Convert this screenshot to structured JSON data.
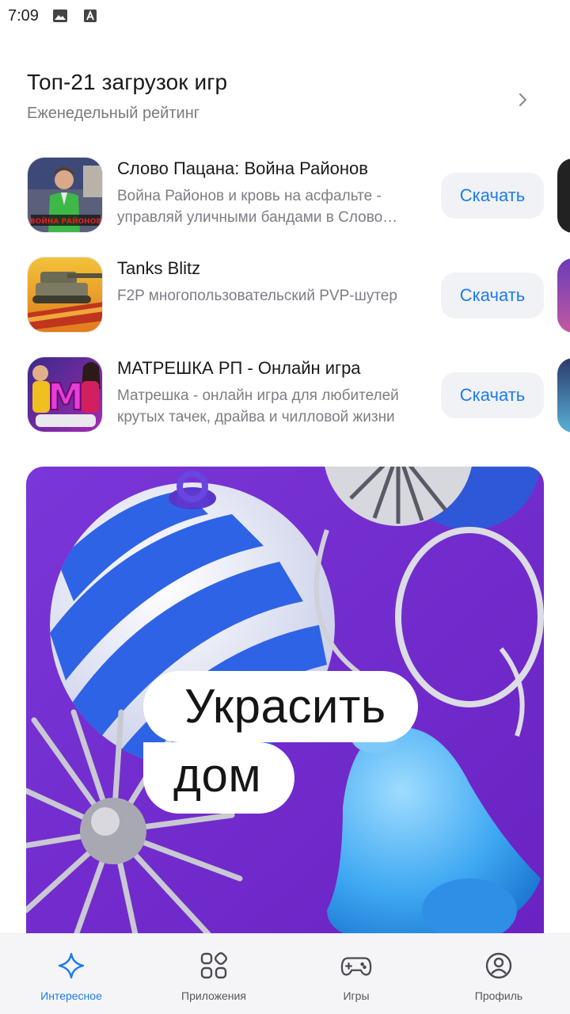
{
  "status": {
    "time": "7:09",
    "icons": [
      "image-icon",
      "font-a-icon"
    ]
  },
  "section": {
    "title": "Топ-21 загрузок игр",
    "subtitle": "Еженедельный рейтинг"
  },
  "apps": [
    {
      "name": "Слово Пацана: Война Районов",
      "desc": "Война Районов и кровь на асфальте - управляй уличными бандами в Слово Пацана",
      "button": "Скачать",
      "icon_text": "ВОЙНА РАЙОНОВ"
    },
    {
      "name": "Tanks Blitz",
      "desc": "F2P многопользовательский PVP-шутер",
      "button": "Скачать"
    },
    {
      "name": "МАТРЕШКА РП - Онлайн игра",
      "desc": "Матрешка - онлайн игра для любителей крутых тачек, драйва и чилловой жизни",
      "button": "Скачать",
      "icon_text": "M"
    }
  ],
  "banner": {
    "line1": "Украсить",
    "line2": "дом",
    "bg_color": "#7b2fd6"
  },
  "nav": [
    {
      "label": "Интересное",
      "icon": "sparkle-icon",
      "active": true
    },
    {
      "label": "Приложения",
      "icon": "apps-grid-icon",
      "active": false
    },
    {
      "label": "Игры",
      "icon": "gamepad-icon",
      "active": false
    },
    {
      "label": "Профиль",
      "icon": "profile-icon",
      "active": false
    }
  ],
  "colors": {
    "accent": "#1a7bf2",
    "button_bg": "#f1f2f5",
    "muted_text": "#7d7d85"
  }
}
